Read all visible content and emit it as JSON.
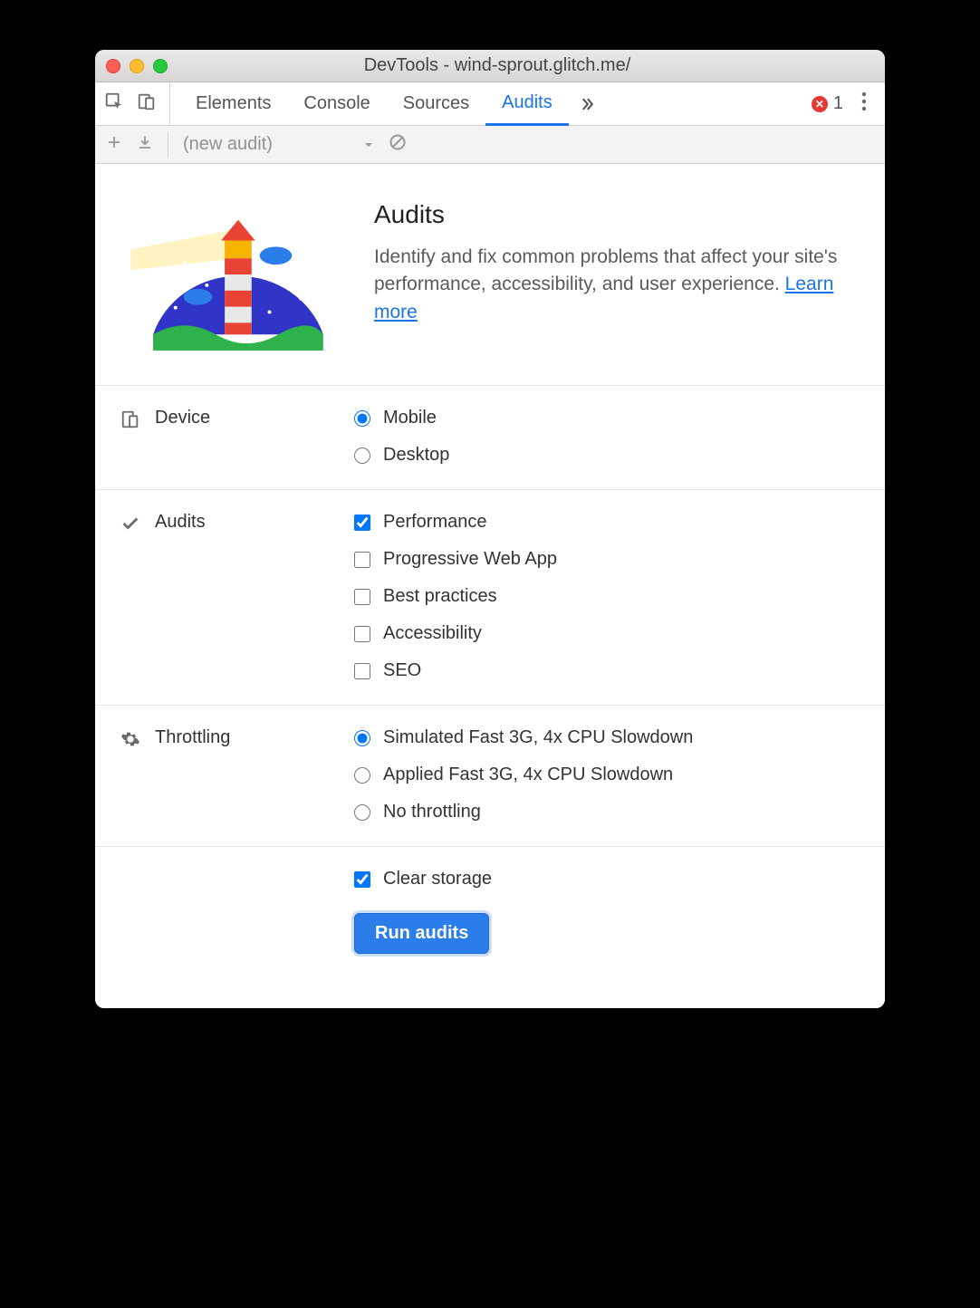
{
  "window": {
    "title": "DevTools - wind-sprout.glitch.me/"
  },
  "tabs": {
    "items": [
      "Elements",
      "Console",
      "Sources",
      "Audits"
    ],
    "active": "Audits",
    "error_count": "1"
  },
  "subbar": {
    "audit_label": "(new audit)"
  },
  "intro": {
    "heading": "Audits",
    "body": "Identify and fix common problems that affect your site's performance, accessibility, and user experience. ",
    "link_text": "Learn more"
  },
  "sections": {
    "device": {
      "label": "Device",
      "options": [
        {
          "label": "Mobile",
          "checked": true
        },
        {
          "label": "Desktop",
          "checked": false
        }
      ]
    },
    "audits": {
      "label": "Audits",
      "options": [
        {
          "label": "Performance",
          "checked": true
        },
        {
          "label": "Progressive Web App",
          "checked": false
        },
        {
          "label": "Best practices",
          "checked": false
        },
        {
          "label": "Accessibility",
          "checked": false
        },
        {
          "label": "SEO",
          "checked": false
        }
      ]
    },
    "throttling": {
      "label": "Throttling",
      "options": [
        {
          "label": "Simulated Fast 3G, 4x CPU Slowdown",
          "checked": true
        },
        {
          "label": "Applied Fast 3G, 4x CPU Slowdown",
          "checked": false
        },
        {
          "label": "No throttling",
          "checked": false
        }
      ]
    }
  },
  "footer": {
    "clear_storage_label": "Clear storage",
    "clear_storage_checked": true,
    "run_label": "Run audits"
  }
}
